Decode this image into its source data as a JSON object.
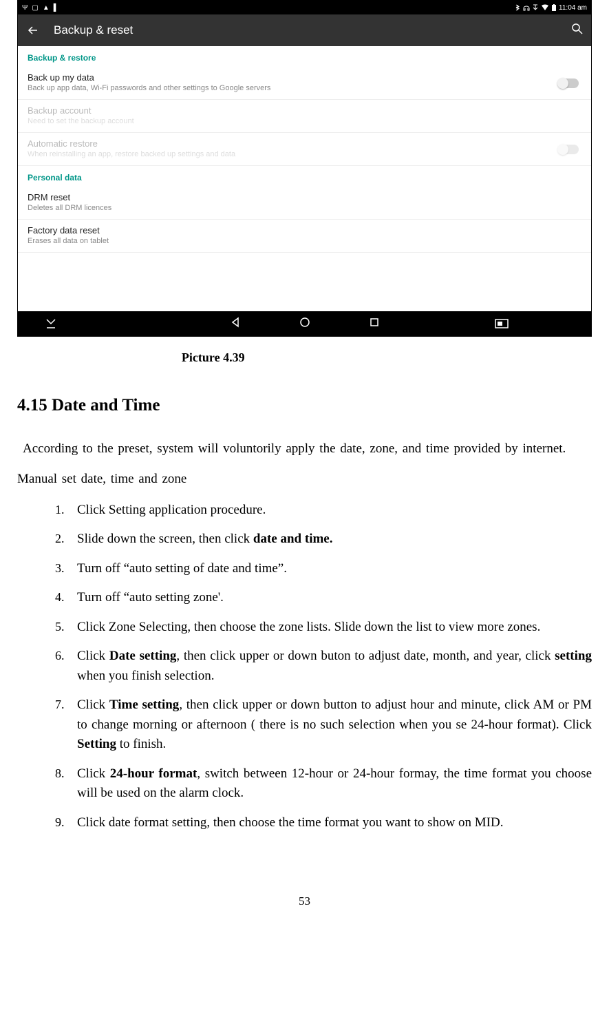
{
  "screenshot": {
    "statusBar": {
      "time": "11:04 am"
    },
    "appBar": {
      "title": "Backup & reset"
    },
    "section1": {
      "header": "Backup & restore",
      "row1": {
        "title": "Back up my data",
        "sub": "Back up app data, Wi-Fi passwords and other settings to Google servers"
      },
      "row2": {
        "title": "Backup account",
        "sub": "Need to set the backup account"
      },
      "row3": {
        "title": "Automatic restore",
        "sub": "When reinstalling an app, restore backed up settings and data"
      }
    },
    "section2": {
      "header": "Personal data",
      "row1": {
        "title": "DRM reset",
        "sub": "Deletes all DRM licences"
      },
      "row2": {
        "title": "Factory data reset",
        "sub": "Erases all data on tablet"
      }
    }
  },
  "caption": "Picture 4.39",
  "heading": "4.15 Date and Time",
  "intro": "According to the preset, system will voluntorily apply the date, zone, and time provided by internet.",
  "manual": "Manual set date, time and zone",
  "steps": {
    "s1": "Click Setting application procedure.",
    "s2a": "Slide down the screen, then click ",
    "s2b": "date and time.",
    "s3": "Turn off “auto setting of date and time”.",
    "s4": "Turn off “auto setting zone'.",
    "s5": "Click Zone Selecting, then choose the zone lists. Slide down the list to view more zones.",
    "s6a": "Click ",
    "s6b": "Date setting",
    "s6c": ", then click upper or down buton to adjust date, month, and year, click ",
    "s6d": "setting",
    "s6e": " when you finish selection.",
    "s7a": "Click ",
    "s7b": "Time setting",
    "s7c": ", then click upper or down button to adjust hour and minute, click AM or PM to change morning or afternoon ( there is no such selection when you se 24-hour format). Click ",
    "s7d": "Setting",
    "s7e": " to finish.",
    "s8a": "Click ",
    "s8b": "24-hour format",
    "s8c": ", switch between 12-hour or 24-hour formay, the time format you choose will be used on the alarm clock.",
    "s9": "Click date format setting, then choose the time format you want to show on MID."
  },
  "pageNum": "53"
}
